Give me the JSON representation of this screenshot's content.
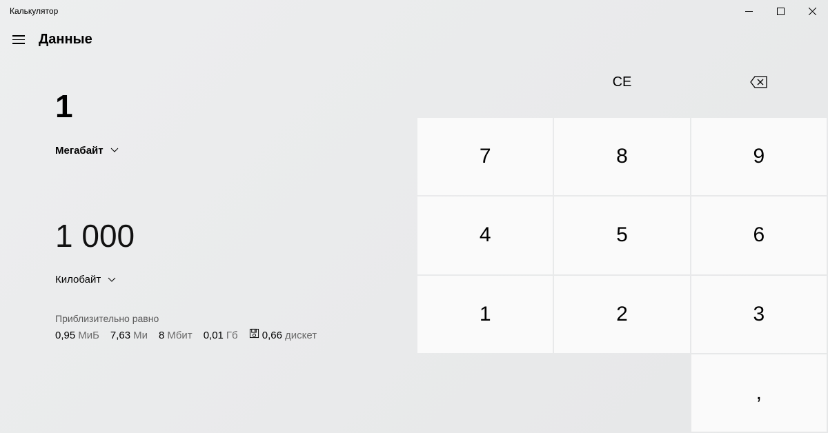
{
  "window": {
    "title": "Калькулятор"
  },
  "header": {
    "mode": "Данные"
  },
  "input": {
    "value": "1",
    "unit": "Мегабайт"
  },
  "output": {
    "value": "1 000",
    "unit": "Килобайт"
  },
  "approx": {
    "label": "Приблизительно равно",
    "items": [
      {
        "value": "0,95",
        "unit": "МиБ"
      },
      {
        "value": "7,63",
        "unit": "Ми"
      },
      {
        "value": "8",
        "unit": "Мбит"
      },
      {
        "value": "0,01",
        "unit": "Гб"
      },
      {
        "value": "0,66",
        "unit": "дискет"
      }
    ]
  },
  "keypad": {
    "ce": "CE",
    "k7": "7",
    "k8": "8",
    "k9": "9",
    "k4": "4",
    "k5": "5",
    "k6": "6",
    "k1": "1",
    "k2": "2",
    "k3": "3",
    "dot": ","
  }
}
